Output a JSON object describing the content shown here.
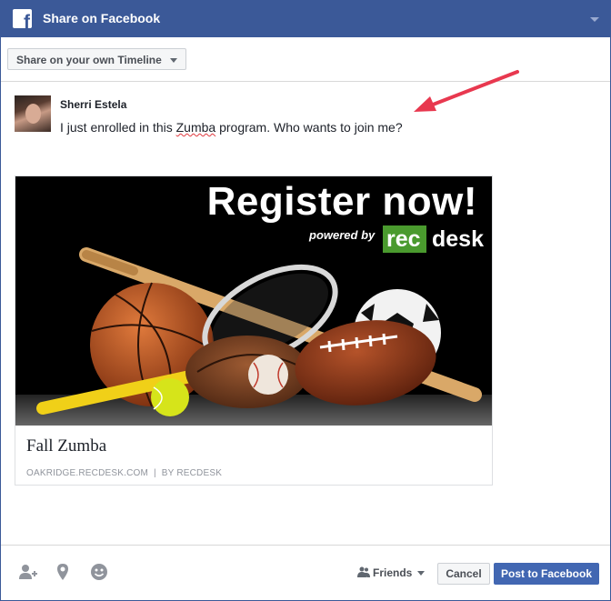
{
  "window": {
    "title": "Share on Facebook",
    "logo_glyph": "f"
  },
  "toolbar": {
    "share_target": "Share on your own Timeline"
  },
  "post": {
    "author": "Sherri Estela",
    "text_before": "I just enrolled in this ",
    "text_highlight": "Zumba",
    "text_after": " program. Who wants to join me?"
  },
  "link_card": {
    "image": {
      "headline": "Register now!",
      "powered_by": "powered by",
      "brand_rec": "rec",
      "brand_desk": "desk"
    },
    "title": "Fall Zumba",
    "domain": "OAKRIDGE.RECDESK.COM",
    "separator": "|",
    "byline": "BY RECDESK"
  },
  "footer": {
    "icons": [
      "tag-friends-icon",
      "location-icon",
      "feeling-icon"
    ],
    "audience": "Friends",
    "cancel_label": "Cancel",
    "post_label": "Post to Facebook"
  },
  "colors": {
    "facebook_blue": "#3b5998",
    "post_button": "#4267b2",
    "annotation_arrow": "#e8384f",
    "recdesk_green": "#4a9a2e"
  }
}
